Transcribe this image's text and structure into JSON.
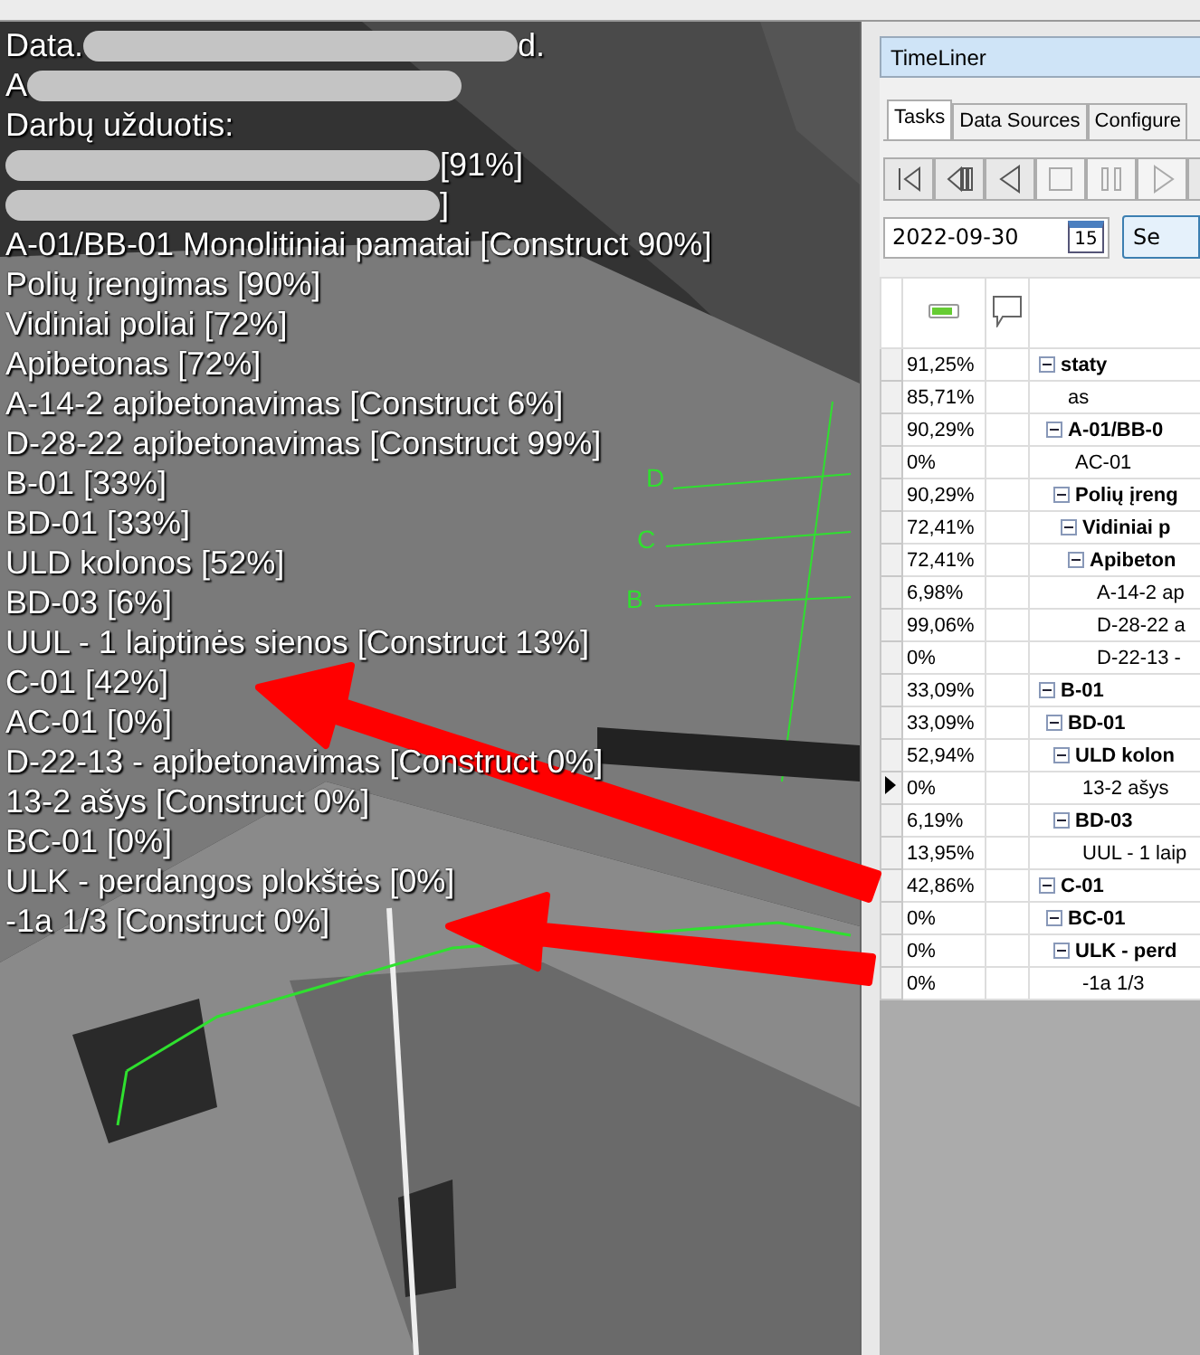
{
  "viewport": {
    "overlay_lines": [
      {
        "segments": [
          {
            "kind": "text",
            "text": "Data."
          },
          {
            "kind": "redacted"
          },
          {
            "kind": "text",
            "text": "d."
          }
        ]
      },
      {
        "segments": [
          {
            "kind": "text",
            "text": "A"
          },
          {
            "kind": "redacted"
          }
        ]
      },
      {
        "segments": [
          {
            "kind": "text",
            "text": "Darbų užduotis:"
          }
        ]
      },
      {
        "segments": [
          {
            "kind": "redacted"
          },
          {
            "kind": "text",
            "text": "[91%]"
          }
        ]
      },
      {
        "segments": [
          {
            "kind": "redacted"
          },
          {
            "kind": "text",
            "text": "]"
          }
        ]
      },
      {
        "segments": [
          {
            "kind": "text",
            "text": "A-01/BB-01 Monolitiniai pamatai [Construct 90%]"
          }
        ]
      },
      {
        "segments": [
          {
            "kind": "text",
            "text": "Polių įrengimas [90%]"
          }
        ]
      },
      {
        "segments": [
          {
            "kind": "text",
            "text": "Vidiniai poliai [72%]"
          }
        ]
      },
      {
        "segments": [
          {
            "kind": "text",
            "text": "Apibetonas [72%]"
          }
        ]
      },
      {
        "segments": [
          {
            "kind": "text",
            "text": "A-14-2 apibetonavimas [Construct 6%]"
          }
        ]
      },
      {
        "segments": [
          {
            "kind": "text",
            "text": "D-28-22 apibetonavimas [Construct 99%]"
          }
        ]
      },
      {
        "segments": [
          {
            "kind": "text",
            "text": "B-01 [33%]"
          }
        ]
      },
      {
        "segments": [
          {
            "kind": "text",
            "text": "BD-01 [33%]"
          }
        ]
      },
      {
        "segments": [
          {
            "kind": "text",
            "text": "ULD kolonos [52%]"
          }
        ]
      },
      {
        "segments": [
          {
            "kind": "text",
            "text": "BD-03 [6%]"
          }
        ]
      },
      {
        "segments": [
          {
            "kind": "text",
            "text": "UUL - 1 laiptinės sienos [Construct 13%]"
          }
        ]
      },
      {
        "segments": [
          {
            "kind": "text",
            "text": "C-01 [42%]"
          }
        ]
      },
      {
        "segments": [
          {
            "kind": "text",
            "text": "AC-01 [0%]"
          }
        ]
      },
      {
        "segments": [
          {
            "kind": "text",
            "text": "D-22-13 - apibetonavimas [Construct 0%]"
          }
        ]
      },
      {
        "segments": [
          {
            "kind": "text",
            "text": "13-2 ašys [Construct 0%]"
          }
        ]
      },
      {
        "segments": [
          {
            "kind": "text",
            "text": "BC-01 [0%]"
          }
        ]
      },
      {
        "segments": [
          {
            "kind": "text",
            "text": "ULK - perdangos plokštės [0%]"
          }
        ]
      },
      {
        "segments": [
          {
            "kind": "text",
            "text": "-1a 1/3 [Construct 0%]"
          }
        ]
      }
    ],
    "grid_labels": [
      "D",
      "C",
      "B"
    ]
  },
  "timeliner": {
    "title": "TimeLiner",
    "tabs": [
      {
        "label": "Tasks",
        "selected": true
      },
      {
        "label": "Data Sources",
        "selected": false
      },
      {
        "label": "Configure",
        "selected": false
      }
    ],
    "toolbar": [
      {
        "kind": "rewind",
        "disabled": false
      },
      {
        "kind": "step-back",
        "disabled": false
      },
      {
        "kind": "play-back",
        "disabled": false
      },
      {
        "kind": "stop",
        "disabled": true
      },
      {
        "kind": "pause",
        "disabled": true
      },
      {
        "kind": "play",
        "disabled": true
      },
      {
        "kind": "partial",
        "disabled": false
      }
    ],
    "date": {
      "value": "2022-09-30",
      "calendar_day": "15"
    },
    "set_button": "Se",
    "tasks": [
      {
        "progress": "91,25%",
        "name": "staty",
        "current": false,
        "expanded": true,
        "children": [
          {
            "progress": "85,71%",
            "name": "as",
            "current": false
          },
          {
            "progress": "90,29%",
            "name": "A-01/BB-0",
            "current": false,
            "expanded": true,
            "children": [
              {
                "progress": "0%",
                "name": "AC-01",
                "current": false
              },
              {
                "progress": "90,29%",
                "name": "Polių įreng",
                "current": false,
                "expanded": true,
                "children": [
                  {
                    "progress": "72,41%",
                    "name": "Vidiniai p",
                    "current": false,
                    "expanded": true,
                    "children": [
                      {
                        "progress": "72,41%",
                        "name": "Apibeton",
                        "current": false,
                        "expanded": true,
                        "children": [
                          {
                            "progress": "6,98%",
                            "name": "A-14-2 ap",
                            "current": false
                          },
                          {
                            "progress": "99,06%",
                            "name": "D-28-22 a",
                            "current": false
                          },
                          {
                            "progress": "0%",
                            "name": "D-22-13 -",
                            "current": false
                          }
                        ]
                      }
                    ]
                  }
                ]
              }
            ]
          }
        ]
      },
      {
        "progress": "33,09%",
        "name": "B-01",
        "current": false,
        "expanded": true,
        "children": [
          {
            "progress": "33,09%",
            "name": "BD-01",
            "current": false,
            "expanded": true,
            "children": [
              {
                "progress": "52,94%",
                "name": "ULD kolon",
                "current": false,
                "expanded": true,
                "children": [
                  {
                    "progress": "0%",
                    "name": "13-2 ašys",
                    "current": true
                  }
                ]
              },
              {
                "progress": "6,19%",
                "name": "BD-03",
                "current": false,
                "expanded": true,
                "children": [
                  {
                    "progress": "13,95%",
                    "name": "UUL - 1 laip",
                    "current": false
                  }
                ]
              }
            ]
          }
        ]
      },
      {
        "progress": "42,86%",
        "name": "C-01",
        "current": false,
        "expanded": true,
        "children": [
          {
            "progress": "0%",
            "name": "BC-01",
            "current": false,
            "expanded": true,
            "children": [
              {
                "progress": "0%",
                "name": "ULK - perd",
                "current": false,
                "expanded": true,
                "children": [
                  {
                    "progress": "0%",
                    "name": "-1a 1/3",
                    "current": false
                  }
                ]
              }
            ]
          }
        ]
      }
    ]
  }
}
